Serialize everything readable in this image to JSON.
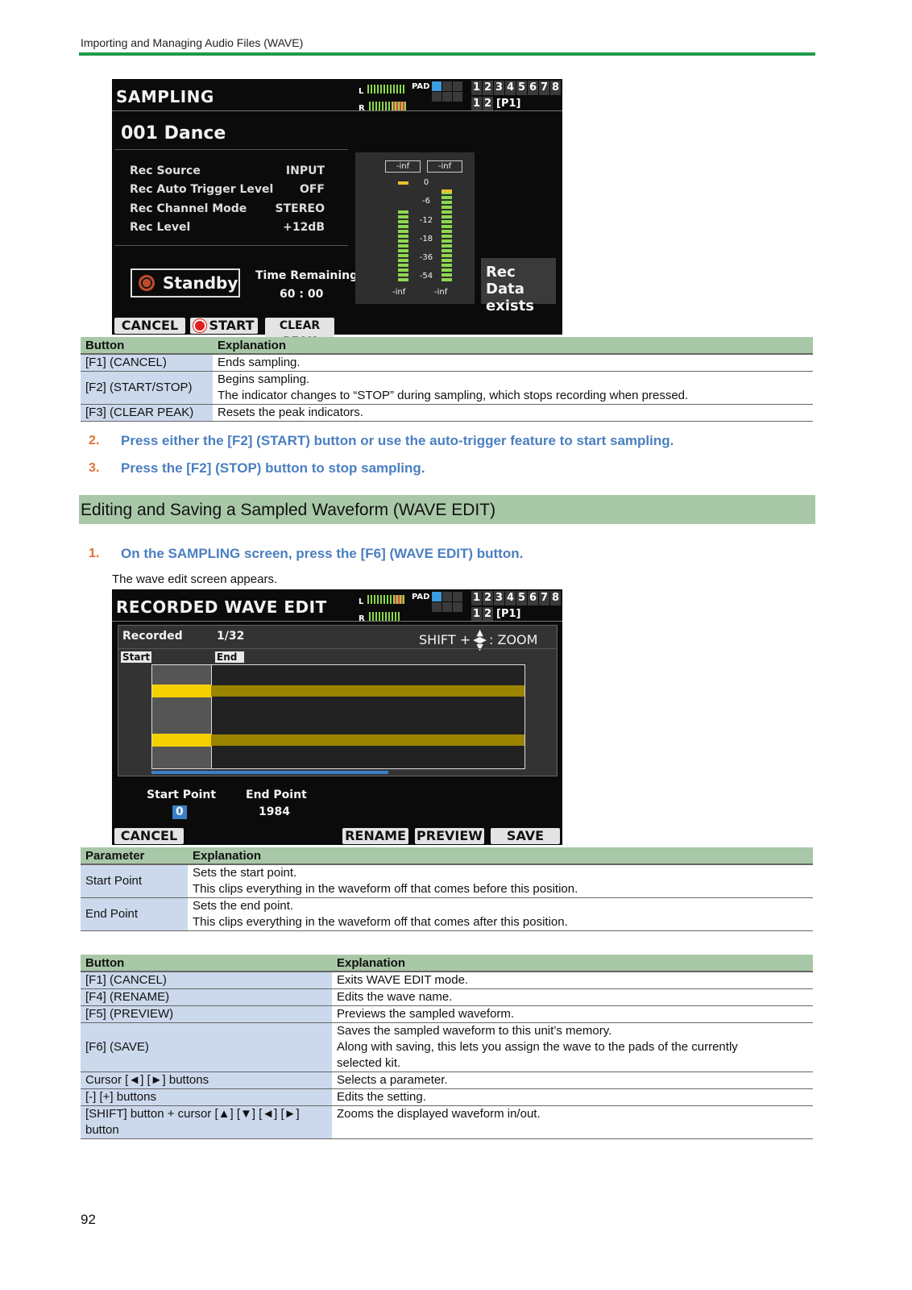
{
  "header": {
    "title": "Importing and Managing Audio Files (WAVE)"
  },
  "screen1": {
    "title": "SAMPLING",
    "meter_l": "L",
    "meter_r": "R",
    "pad": "PAD",
    "numbers_top": [
      "1",
      "2",
      "3",
      "4",
      "5",
      "6",
      "7",
      "8"
    ],
    "numbers_bottom": [
      "1",
      "2"
    ],
    "page": "[P1]",
    "kit": "001 Dance",
    "params": [
      {
        "label": "Rec Source",
        "value": "INPUT"
      },
      {
        "label": "Rec Auto Trigger Level",
        "value": "OFF"
      },
      {
        "label": "Rec Channel Mode",
        "value": "STEREO"
      },
      {
        "label": "Rec Level",
        "value": "+12dB"
      }
    ],
    "status": "Standby",
    "time_label": "Time Remaining",
    "time_value": "60 : 00",
    "peak_l": "-inf",
    "peak_r": "-inf",
    "scale": [
      "0",
      "-6",
      "-12",
      "-18",
      "-36",
      "-54"
    ],
    "bottom_l": "-inf",
    "bottom_r": "-inf",
    "rec_data": [
      "Rec Data",
      "exists"
    ],
    "softkeys": [
      "CANCEL",
      "START",
      "CLEAR PEAK"
    ]
  },
  "table1": {
    "headers": [
      "Button",
      "Explanation"
    ],
    "rows": [
      {
        "button": "[F1] (CANCEL)",
        "lines": [
          "Ends sampling."
        ]
      },
      {
        "button": "[F2] (START/STOP)",
        "lines": [
          "Begins sampling.",
          "The indicator changes to “STOP” during sampling, which stops recording when pressed."
        ]
      },
      {
        "button": "[F3] (CLEAR PEAK)",
        "lines": [
          "Resets the peak indicators."
        ]
      }
    ]
  },
  "steps_a": [
    {
      "num": "2.",
      "text": "Press either the [F2] (START) button or use the auto-trigger feature to start sampling."
    },
    {
      "num": "3.",
      "text": "Press the [F2] (STOP) button to stop sampling."
    }
  ],
  "section": {
    "title": "Editing and Saving a Sampled Waveform (WAVE EDIT)"
  },
  "step_b": {
    "num": "1.",
    "text": "On the SAMPLING screen, press the [F6] (WAVE EDIT) button."
  },
  "step_b_note": "The wave edit screen appears.",
  "screen2": {
    "title": "RECORDED WAVE EDIT",
    "meter_l": "L",
    "meter_r": "R",
    "pad": "PAD",
    "numbers_top": [
      "1",
      "2",
      "3",
      "4",
      "5",
      "6",
      "7",
      "8"
    ],
    "numbers_bottom": [
      "1",
      "2"
    ],
    "page": "[P1]",
    "recorded": "Recorded",
    "count": "1/32",
    "zoom_pre": "SHIFT +",
    "zoom_post": ": ZOOM",
    "start_tag": "Start",
    "end_tag": "End",
    "start_label": "Start Point",
    "start_value": "0",
    "end_label": "End Point",
    "end_value": "1984",
    "softkeys": [
      "CANCEL",
      "RENAME",
      "PREVIEW",
      "SAVE"
    ]
  },
  "table2": {
    "headers": [
      "Parameter",
      "Explanation"
    ],
    "rows": [
      {
        "param": "Start Point",
        "lines": [
          "Sets the start point.",
          "This clips everything in the waveform off that comes before this position."
        ]
      },
      {
        "param": "End Point",
        "lines": [
          "Sets the end point.",
          "This clips everything in the waveform off that comes after this position."
        ]
      }
    ]
  },
  "table3": {
    "headers": [
      "Button",
      "Explanation"
    ],
    "rows": [
      {
        "button": [
          "[F1] (CANCEL)"
        ],
        "lines": [
          "Exits WAVE EDIT mode."
        ]
      },
      {
        "button": [
          "[F4] (RENAME)"
        ],
        "lines": [
          "Edits the wave name."
        ]
      },
      {
        "button": [
          "[F5] (PREVIEW)"
        ],
        "lines": [
          "Previews the sampled waveform."
        ]
      },
      {
        "button": [
          "[F6] (SAVE)"
        ],
        "lines": [
          "Saves the sampled waveform to this unit’s memory.",
          "Along with saving, this lets you assign the wave to the pads of the currently",
          "selected kit."
        ]
      },
      {
        "button": [
          "Cursor [◄] [►] buttons"
        ],
        "lines": [
          "Selects a parameter."
        ]
      },
      {
        "button": [
          "[-] [+] buttons"
        ],
        "lines": [
          "Edits the setting."
        ]
      },
      {
        "button": [
          "[SHIFT] button + cursor [▲] [▼] [◄] [►]",
          "button"
        ],
        "lines": [
          "Zooms the displayed waveform in/out."
        ]
      }
    ]
  },
  "footer": {
    "page_number": "92"
  }
}
